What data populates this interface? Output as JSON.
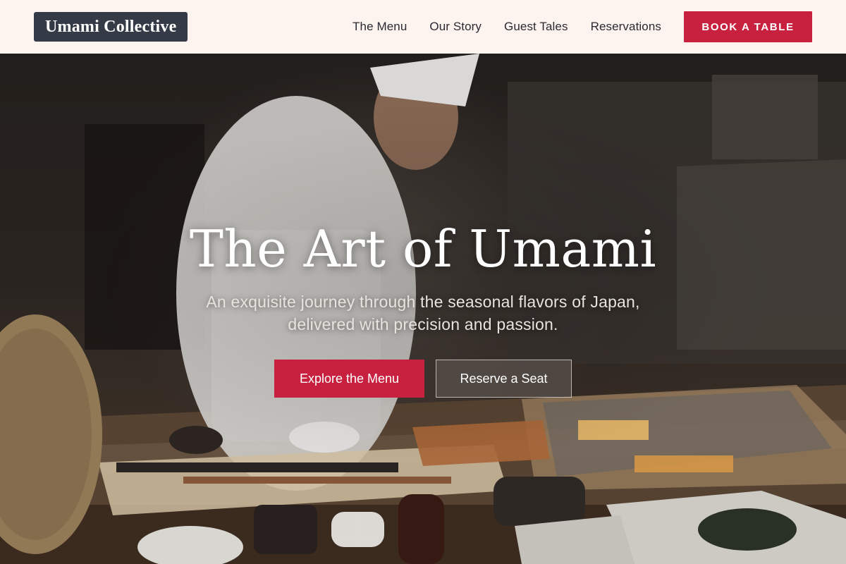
{
  "header": {
    "logo": "Umami Collective",
    "nav": [
      {
        "label": "The Menu"
      },
      {
        "label": "Our Story"
      },
      {
        "label": "Guest Tales"
      },
      {
        "label": "Reservations"
      }
    ],
    "cta": "BOOK A TABLE"
  },
  "hero": {
    "title": "The Art of Umami",
    "subtitle": "An exquisite journey through the seasonal flavors of Japan, delivered with precision and passion.",
    "primary_button": "Explore the Menu",
    "secondary_button": "Reserve a Seat",
    "background_image": "sushi-chef-preparing-at-counter"
  },
  "colors": {
    "accent": "#c8203f",
    "header_bg": "#fdf4f0",
    "logo_bg": "#343a46"
  }
}
